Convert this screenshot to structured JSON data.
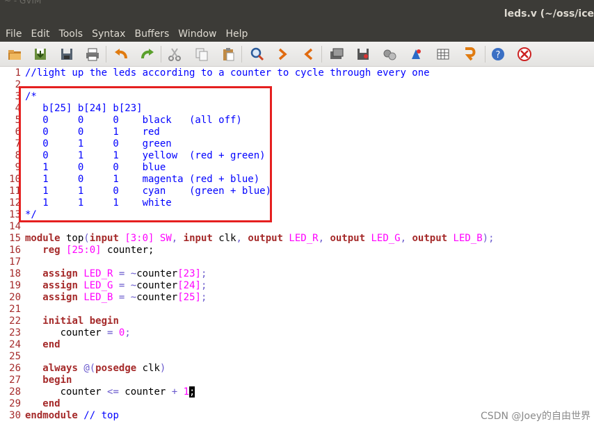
{
  "window": {
    "title": "leds.v (~/oss/ice",
    "prev_window_fragment": "~ - GVIM"
  },
  "menu": [
    "File",
    "Edit",
    "Tools",
    "Syntax",
    "Buffers",
    "Window",
    "Help"
  ],
  "toolbar": [
    {
      "name": "open-icon"
    },
    {
      "name": "save-icon"
    },
    {
      "name": "save-all-icon"
    },
    {
      "name": "print-icon"
    },
    {
      "name": "undo-icon"
    },
    {
      "name": "redo-icon"
    },
    {
      "name": "cut-icon"
    },
    {
      "name": "copy-icon"
    },
    {
      "name": "paste-icon"
    },
    {
      "name": "find-replace-icon"
    },
    {
      "name": "find-next-icon"
    },
    {
      "name": "find-prev-icon"
    },
    {
      "name": "load-session-icon"
    },
    {
      "name": "save-session-icon"
    },
    {
      "name": "run-script-icon"
    },
    {
      "name": "make-icon"
    },
    {
      "name": "shell-icon"
    },
    {
      "name": "ctags-icon"
    },
    {
      "name": "help-icon"
    },
    {
      "name": "find-help-icon"
    }
  ],
  "editor": {
    "lines": [
      [
        [
          "cm",
          "//light up the leds according to a counter to cycle through every one"
        ]
      ],
      [],
      [
        [
          "cm",
          "/*"
        ]
      ],
      [
        [
          "cm",
          "   b[25] b[24] b[23]"
        ]
      ],
      [
        [
          "cm",
          "   0     0     0    black   (all off)"
        ]
      ],
      [
        [
          "cm",
          "   0     0     1    red"
        ]
      ],
      [
        [
          "cm",
          "   0     1     0    green"
        ]
      ],
      [
        [
          "cm",
          "   0     1     1    yellow  (red + green)"
        ]
      ],
      [
        [
          "cm",
          "   1     0     0    blue"
        ]
      ],
      [
        [
          "cm",
          "   1     0     1    magenta (red + blue)"
        ]
      ],
      [
        [
          "cm",
          "   1     1     0    cyan    (green + blue)"
        ]
      ],
      [
        [
          "cm",
          "   1     1     1    white"
        ]
      ],
      [
        [
          "cm",
          "*/"
        ]
      ],
      [],
      [
        [
          "kw",
          "module"
        ],
        [
          "",
          " top"
        ],
        [
          "pn",
          "("
        ],
        [
          "kw",
          "input"
        ],
        [
          "",
          " "
        ],
        [
          "nm",
          "[3:0]"
        ],
        [
          "",
          " "
        ],
        [
          "nm",
          "SW"
        ],
        [
          "pn",
          ","
        ],
        [
          "",
          " "
        ],
        [
          "kw",
          "input"
        ],
        [
          "",
          " clk"
        ],
        [
          "pn",
          ","
        ],
        [
          "",
          " "
        ],
        [
          "kw",
          "output"
        ],
        [
          "",
          " "
        ],
        [
          "nm",
          "LED_R"
        ],
        [
          "pn",
          ","
        ],
        [
          "",
          " "
        ],
        [
          "kw",
          "output"
        ],
        [
          "",
          " "
        ],
        [
          "nm",
          "LED_G"
        ],
        [
          "pn",
          ","
        ],
        [
          "",
          " "
        ],
        [
          "kw",
          "output"
        ],
        [
          "",
          " "
        ],
        [
          "nm",
          "LED_B"
        ],
        [
          "pn",
          ");"
        ]
      ],
      [
        [
          "",
          "   "
        ],
        [
          "kw",
          "reg"
        ],
        [
          "",
          " "
        ],
        [
          "nm",
          "[25:0]"
        ],
        [
          "",
          " counter;"
        ]
      ],
      [],
      [
        [
          "",
          "   "
        ],
        [
          "kw",
          "assign"
        ],
        [
          "",
          " "
        ],
        [
          "nm",
          "LED_R"
        ],
        [
          "",
          " "
        ],
        [
          "pn",
          "="
        ],
        [
          "",
          " "
        ],
        [
          "pn",
          "~"
        ],
        [
          "",
          "counter"
        ],
        [
          "nm",
          "[23]"
        ],
        [
          "pn",
          ";"
        ]
      ],
      [
        [
          "",
          "   "
        ],
        [
          "kw",
          "assign"
        ],
        [
          "",
          " "
        ],
        [
          "nm",
          "LED_G"
        ],
        [
          "",
          " "
        ],
        [
          "pn",
          "="
        ],
        [
          "",
          " "
        ],
        [
          "pn",
          "~"
        ],
        [
          "",
          "counter"
        ],
        [
          "nm",
          "[24]"
        ],
        [
          "pn",
          ";"
        ]
      ],
      [
        [
          "",
          "   "
        ],
        [
          "kw",
          "assign"
        ],
        [
          "",
          " "
        ],
        [
          "nm",
          "LED_B"
        ],
        [
          "",
          " "
        ],
        [
          "pn",
          "="
        ],
        [
          "",
          " "
        ],
        [
          "pn",
          "~"
        ],
        [
          "",
          "counter"
        ],
        [
          "nm",
          "[25]"
        ],
        [
          "pn",
          ";"
        ]
      ],
      [],
      [
        [
          "",
          "   "
        ],
        [
          "kw",
          "initial"
        ],
        [
          "",
          " "
        ],
        [
          "kw",
          "begin"
        ]
      ],
      [
        [
          "",
          "      counter "
        ],
        [
          "pn",
          "="
        ],
        [
          "",
          " "
        ],
        [
          "nm",
          "0"
        ],
        [
          "pn",
          ";"
        ]
      ],
      [
        [
          "",
          "   "
        ],
        [
          "kw",
          "end"
        ]
      ],
      [],
      [
        [
          "",
          "   "
        ],
        [
          "kw",
          "always"
        ],
        [
          "",
          " "
        ],
        [
          "pn",
          "@("
        ],
        [
          "kw",
          "posedge"
        ],
        [
          "",
          " clk"
        ],
        [
          "pn",
          ")"
        ]
      ],
      [
        [
          "",
          "   "
        ],
        [
          "kw",
          "begin"
        ]
      ],
      [
        [
          "",
          "      counter "
        ],
        [
          "pn",
          "<="
        ],
        [
          "",
          " counter "
        ],
        [
          "pn",
          "+"
        ],
        [
          "",
          " "
        ],
        [
          "nm",
          "1"
        ],
        [
          "cur",
          ";"
        ]
      ],
      [
        [
          "",
          "   "
        ],
        [
          "kw",
          "end"
        ]
      ],
      [
        [
          "kw",
          "endmodule"
        ],
        [
          "",
          " "
        ],
        [
          "cm",
          "// top"
        ]
      ]
    ]
  },
  "watermark": "CSDN @Joey的自由世界"
}
